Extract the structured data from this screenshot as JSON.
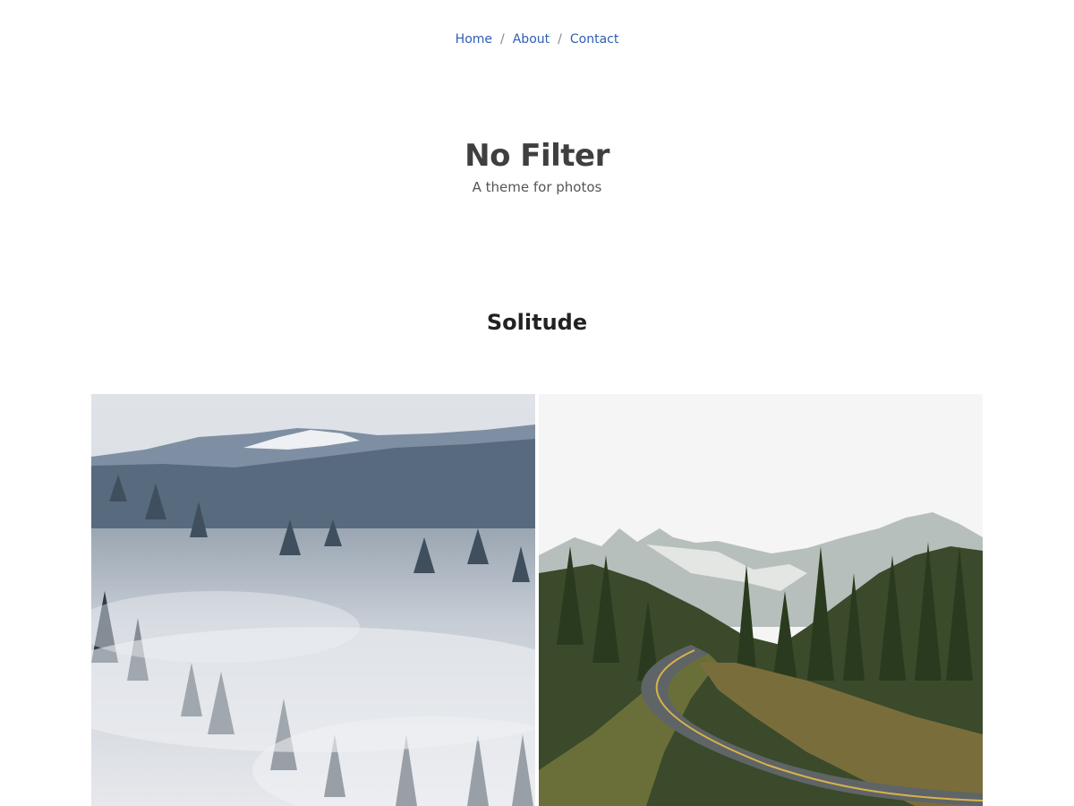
{
  "nav": {
    "items": [
      {
        "label": "Home"
      },
      {
        "label": "About"
      },
      {
        "label": "Contact"
      }
    ],
    "separator": "/"
  },
  "site": {
    "title": "No Filter",
    "tagline": "A theme for photos"
  },
  "post": {
    "title": "Solitude"
  },
  "gallery": {
    "photos": [
      {
        "subject": "misty-forest-photo"
      },
      {
        "subject": "mountain-road-photo"
      }
    ]
  },
  "colors": {
    "link": "#2f5fb3",
    "title": "#3f3f3f",
    "post_title": "#222222"
  }
}
